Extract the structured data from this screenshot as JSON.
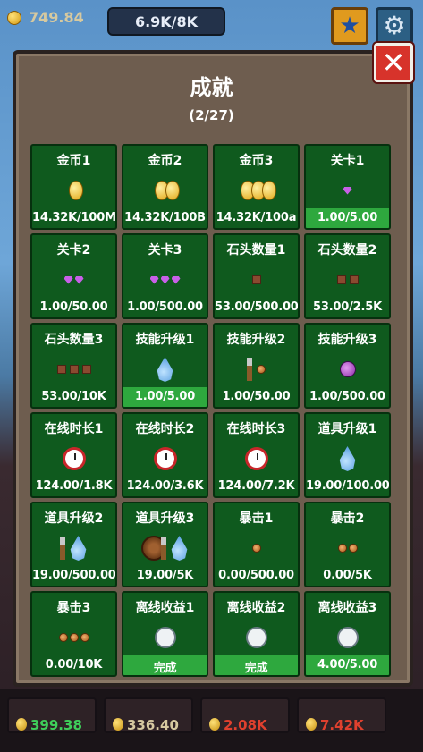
{
  "hud": {
    "coins": "749.84",
    "progress": "6.9K/8K",
    "star_icon": "star-icon",
    "gear_icon": "gear-icon"
  },
  "modal": {
    "title": "成就",
    "count": "(2/27)",
    "close_icon": "close-icon",
    "achievements": [
      {
        "name": "金币1",
        "icon": "coin-icon",
        "value": "14.32K/100M",
        "progress": 0.0
      },
      {
        "name": "金币2",
        "icon": "coin-stack-icon",
        "value": "14.32K/100B",
        "progress": 0.0
      },
      {
        "name": "金币3",
        "icon": "coin-pile-icon",
        "value": "14.32K/100a",
        "progress": 0.0
      },
      {
        "name": "关卡1",
        "icon": "gem-icon",
        "value": "1.00/5.00",
        "progress": 1.0
      },
      {
        "name": "关卡2",
        "icon": "gem-pair-icon",
        "value": "1.00/50.00",
        "progress": 0.0
      },
      {
        "name": "关卡3",
        "icon": "gem-cluster-icon",
        "value": "1.00/500.00",
        "progress": 0.0
      },
      {
        "name": "石头数量1",
        "icon": "stone-icon",
        "value": "53.00/500.00",
        "progress": 0.0
      },
      {
        "name": "石头数量2",
        "icon": "stone-pair-icon",
        "value": "53.00/2.5K",
        "progress": 0.0
      },
      {
        "name": "石头数量3",
        "icon": "stone-pile-icon",
        "value": "53.00/10K",
        "progress": 0.0
      },
      {
        "name": "技能升级1",
        "icon": "water-drop-icon",
        "value": "1.00/5.00",
        "progress": 1.0
      },
      {
        "name": "技能升级2",
        "icon": "shovel-icon",
        "value": "1.00/50.00",
        "progress": 0.0
      },
      {
        "name": "技能升级3",
        "icon": "potion-icon",
        "value": "1.00/500.00",
        "progress": 0.0
      },
      {
        "name": "在线时长1",
        "icon": "clock-icon",
        "value": "124.00/1.8K",
        "progress": 0.0
      },
      {
        "name": "在线时长2",
        "icon": "clock-icon",
        "value": "124.00/3.6K",
        "progress": 0.0
      },
      {
        "name": "在线时长3",
        "icon": "clock-icon",
        "value": "124.00/7.2K",
        "progress": 0.0
      },
      {
        "name": "道具升级1",
        "icon": "water-drop-icon",
        "value": "19.00/100.00",
        "progress": 0.0
      },
      {
        "name": "道具升级2",
        "icon": "shovel-drop-icon",
        "value": "19.00/500.00",
        "progress": 0.0
      },
      {
        "name": "道具升级3",
        "icon": "shield-shovel-drop-icon",
        "value": "19.00/5K",
        "progress": 0.0
      },
      {
        "name": "暴击1",
        "icon": "crit-icon",
        "value": "0.00/500.00",
        "progress": 0.0
      },
      {
        "name": "暴击2",
        "icon": "crit-pair-icon",
        "value": "0.00/5K",
        "progress": 0.0
      },
      {
        "name": "暴击3",
        "icon": "crit-pile-icon",
        "value": "0.00/10K",
        "progress": 0.0
      },
      {
        "name": "离线收益1",
        "icon": "stopwatch-icon",
        "value": "完成",
        "progress": 1.0
      },
      {
        "name": "离线收益2",
        "icon": "stopwatch-icon",
        "value": "完成",
        "progress": 1.0
      },
      {
        "name": "离线收益3",
        "icon": "stopwatch-icon",
        "value": "4.00/5.00",
        "progress": 1.0
      }
    ]
  },
  "bottom": {
    "values": [
      "399.38",
      "336.40",
      "2.08K",
      "7.42K"
    ],
    "colors": [
      "#3fcf5a",
      "#d6c9a0",
      "#e0402e",
      "#e0402e"
    ]
  }
}
